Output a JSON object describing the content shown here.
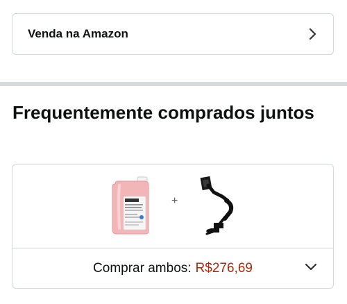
{
  "sell_on_amazon": {
    "label": "Venda na Amazon",
    "icon": "chevron-right-icon"
  },
  "frequently_bought": {
    "title": "Frequentemente comprados juntos",
    "products": [
      {
        "icon": "liquid-soap-gallon-image"
      },
      {
        "icon": "monitor-arm-mount-image"
      }
    ],
    "separator": "+",
    "buy_both_label": "Comprar ambos:",
    "buy_both_price": "R$276,69",
    "expand_icon": "chevron-down-icon"
  },
  "colors": {
    "price": "#b12704",
    "border": "#d5d9d9",
    "divider_band": "#d5dbdb",
    "text": "#0f1111"
  }
}
